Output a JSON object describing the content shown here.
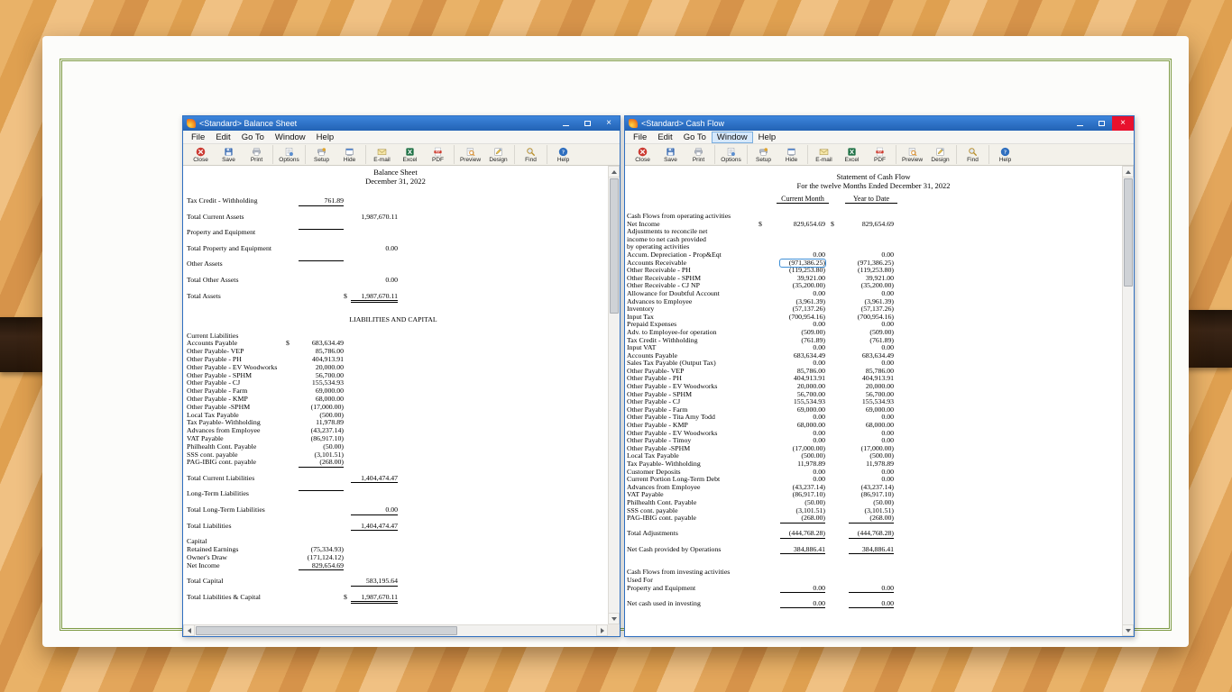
{
  "window_controls": {
    "close": "×"
  },
  "menu": [
    "File",
    "Edit",
    "Go To",
    "Window",
    "Help"
  ],
  "toolbar": {
    "groups": [
      [
        {
          "icon": "close",
          "label": "Close"
        },
        {
          "icon": "save",
          "label": "Save"
        },
        {
          "icon": "print",
          "label": "Print"
        }
      ],
      [
        {
          "icon": "options",
          "label": "Options"
        }
      ],
      [
        {
          "icon": "setup",
          "label": "Setup"
        },
        {
          "icon": "hide",
          "label": "Hide"
        }
      ],
      [
        {
          "icon": "email",
          "label": "E-mail"
        },
        {
          "icon": "excel",
          "label": "Excel"
        },
        {
          "icon": "pdf",
          "label": "PDF"
        }
      ],
      [
        {
          "icon": "preview",
          "label": "Preview"
        },
        {
          "icon": "design",
          "label": "Design"
        }
      ],
      [
        {
          "icon": "find",
          "label": "Find"
        }
      ],
      [
        {
          "icon": "help",
          "label": "Help"
        }
      ]
    ]
  },
  "left_window": {
    "title": "<Standard> Balance Sheet",
    "report": {
      "title": "Balance Sheet",
      "date": "December 31, 2022",
      "rows": [
        {
          "t": "Tax Credit - Withholding",
          "a": "761.89",
          "f": "ua"
        },
        {},
        {
          "t": "Total Current Assets",
          "b": "1,987,670.11"
        },
        {},
        {
          "t": "Property and Equipment",
          "a": "",
          "f": "ua"
        },
        {},
        {
          "t": "Total Property and Equipment",
          "b": "0.00"
        },
        {},
        {
          "t": "Other Assets",
          "a": "",
          "f": "ua"
        },
        {},
        {
          "t": "Total Other Assets",
          "b": "0.00"
        },
        {},
        {
          "t": "Total Assets",
          "db": "$",
          "b": "1,987,670.11",
          "f": "bb"
        },
        {},
        {},
        {
          "t": "LIABILITIES AND CAPITAL",
          "f": "center"
        },
        {},
        {
          "t": "Current Liabilities"
        },
        {
          "t": "Accounts Payable",
          "da": "$",
          "a": "683,634.49"
        },
        {
          "t": "Other Payable- VEP",
          "a": "85,786.00"
        },
        {
          "t": "Other Payable - PH",
          "a": "404,913.91"
        },
        {
          "t": "Other Payable - EV Woodworks",
          "a": "20,000.00"
        },
        {
          "t": "Other Payable - SPHM",
          "a": "56,700.00"
        },
        {
          "t": "Other Payable - CJ",
          "a": "155,534.93"
        },
        {
          "t": "Other Payable - Farm",
          "a": "69,000.00"
        },
        {
          "t": "Other Payable - KMP",
          "a": "68,000.00"
        },
        {
          "t": "Other Payable -SPHM",
          "a": "(17,000.00)"
        },
        {
          "t": "Local Tax Payable",
          "a": "(500.00)"
        },
        {
          "t": "Tax Payable- Withholding",
          "a": "11,978.89"
        },
        {
          "t": "Advances from Employee",
          "a": "(43,237.14)"
        },
        {
          "t": "VAT Payable",
          "a": "(86,917.10)"
        },
        {
          "t": "Philhealth Cont. Payable",
          "a": "(50.00)"
        },
        {
          "t": "SSS cont. payable",
          "a": "(3,101.51)"
        },
        {
          "t": "PAG-IBIG cont. payable",
          "a": "(268.00)",
          "f": "ua"
        },
        {},
        {
          "t": "Total Current Liabilities",
          "b": "1,404,474.47",
          "f": "ub"
        },
        {},
        {
          "t": "Long-Term Liabilities",
          "a": "",
          "f": "ua"
        },
        {},
        {
          "t": "Total Long-Term Liabilities",
          "b": "0.00",
          "f": "ub"
        },
        {},
        {
          "t": "Total Liabilities",
          "b": "1,404,474.47",
          "f": "ub"
        },
        {},
        {
          "t": "Capital"
        },
        {
          "t": "Retained Earnings",
          "a": "(75,334.93)"
        },
        {
          "t": "Owner's Draw",
          "a": "(171,124.12)"
        },
        {
          "t": "Net Income",
          "a": "829,654.69",
          "f": "ua"
        },
        {},
        {
          "t": "Total Capital",
          "b": "583,195.64",
          "f": "ub"
        },
        {},
        {
          "t": "Total Liabilities & Capital",
          "db": "$",
          "b": "1,987,670.11",
          "f": "bb"
        }
      ]
    }
  },
  "right_window": {
    "title": "<Standard> Cash Flow",
    "highlighted_menu": "Window",
    "report": {
      "title": "Statement of Cash Flow",
      "subtitle": "For the twelve Months Ended December 31, 2022",
      "col_headers": [
        "Current Month",
        "Year to Date"
      ],
      "rows": [
        {
          "t": "Cash Flows from operating activities"
        },
        {
          "t": "Net Income",
          "da": "$",
          "a": "829,654.69",
          "db": "$",
          "b": "829,654.69"
        },
        {
          "t": "Adjustments to reconcile net"
        },
        {
          "t": "income to net cash provided"
        },
        {
          "t": "by operating activities"
        },
        {
          "t": "Accum. Depreciation - Prop&Eqt",
          "a": "0.00",
          "b": "0.00"
        },
        {
          "t": "Accounts Receivable",
          "a": "(971,386.25)",
          "b": "(971,386.25)",
          "f": "sel"
        },
        {
          "t": "Other Receivable - PH",
          "a": "(119,253.80)",
          "b": "(119,253.80)"
        },
        {
          "t": "Other Receivable - SPHM",
          "a": "39,921.00",
          "b": "39,921.00"
        },
        {
          "t": "Other Receivable - CJ NP",
          "a": "(35,200.00)",
          "b": "(35,200.00)"
        },
        {
          "t": "Allowance for Doubtful Account",
          "a": "0.00",
          "b": "0.00"
        },
        {
          "t": "Advances to Employee",
          "a": "(3,961.39)",
          "b": "(3,961.39)"
        },
        {
          "t": "Inventory",
          "a": "(57,137.26)",
          "b": "(57,137.26)"
        },
        {
          "t": "Input Tax",
          "a": "(700,954.16)",
          "b": "(700,954.16)"
        },
        {
          "t": "Prepaid Expenses",
          "a": "0.00",
          "b": "0.00"
        },
        {
          "t": "Adv. to Employee-for operation",
          "a": "(509.00)",
          "b": "(509.00)"
        },
        {
          "t": "Tax Credit - Withholding",
          "a": "(761.89)",
          "b": "(761.89)"
        },
        {
          "t": "Input VAT",
          "a": "0.00",
          "b": "0.00"
        },
        {
          "t": "Accounts Payable",
          "a": "683,634.49",
          "b": "683,634.49"
        },
        {
          "t": "Sales Tax Payable (Output Tax)",
          "a": "0.00",
          "b": "0.00"
        },
        {
          "t": "Other Payable- VEP",
          "a": "85,786.00",
          "b": "85,786.00"
        },
        {
          "t": "Other Payable - PH",
          "a": "404,913.91",
          "b": "404,913.91"
        },
        {
          "t": "Other Payable - EV Woodworks",
          "a": "20,000.00",
          "b": "20,000.00"
        },
        {
          "t": "Other Payable - SPHM",
          "a": "56,700.00",
          "b": "56,700.00"
        },
        {
          "t": "Other Payable - CJ",
          "a": "155,534.93",
          "b": "155,534.93"
        },
        {
          "t": "Other Payable - Farm",
          "a": "69,000.00",
          "b": "69,000.00"
        },
        {
          "t": "Other Payable - Tita Amy Todd",
          "a": "0.00",
          "b": "0.00"
        },
        {
          "t": "Other Payable - KMP",
          "a": "68,000.00",
          "b": "68,000.00"
        },
        {
          "t": "Other Payable - EV Woodworks",
          "a": "0.00",
          "b": "0.00"
        },
        {
          "t": "Other Payable - Timoy",
          "a": "0.00",
          "b": "0.00"
        },
        {
          "t": "Other Payable -SPHM",
          "a": "(17,000.00)",
          "b": "(17,000.00)"
        },
        {
          "t": "Local Tax Payable",
          "a": "(500.00)",
          "b": "(500.00)"
        },
        {
          "t": "Tax Payable- Withholding",
          "a": "11,978.89",
          "b": "11,978.89"
        },
        {
          "t": "Customer Deposits",
          "a": "0.00",
          "b": "0.00"
        },
        {
          "t": "Current Portion Long-Term Debt",
          "a": "0.00",
          "b": "0.00"
        },
        {
          "t": "Advances from Employee",
          "a": "(43,237.14)",
          "b": "(43,237.14)"
        },
        {
          "t": "VAT Payable",
          "a": "(86,917.10)",
          "b": "(86,917.10)"
        },
        {
          "t": "Philhealth Cont. Payable",
          "a": "(50.00)",
          "b": "(50.00)"
        },
        {
          "t": "SSS cont. payable",
          "a": "(3,101.51)",
          "b": "(3,101.51)"
        },
        {
          "t": "PAG-IBIG cont. payable",
          "a": "(268.00)",
          "b": "(268.00)",
          "f": "ua ub"
        },
        {},
        {
          "t": "Total Adjustments",
          "a": "(444,768.28)",
          "b": "(444,768.28)",
          "f": "ua ub"
        },
        {},
        {
          "t": "Net Cash provided by Operations",
          "a": "384,886.41",
          "b": "384,886.41",
          "f": "ua ub"
        },
        {},
        {},
        {
          "t": "Cash Flows from investing activities"
        },
        {
          "t": "Used For"
        },
        {
          "t": "Property and Equipment",
          "a": "0.00",
          "b": "0.00",
          "f": "ua ub"
        },
        {},
        {
          "t": "Net cash used in investing",
          "a": "0.00",
          "b": "0.00",
          "f": "ua ub"
        }
      ]
    }
  }
}
